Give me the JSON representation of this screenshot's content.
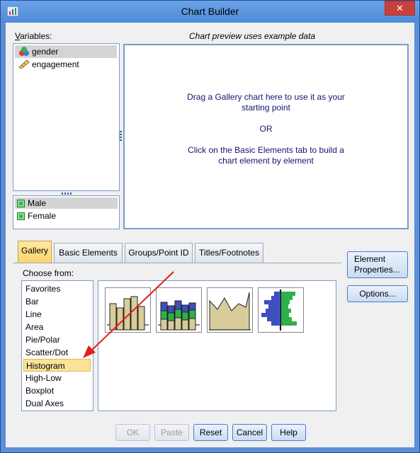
{
  "window": {
    "title": "Chart Builder",
    "close_symbol": "✕"
  },
  "variables": {
    "label": "Variables:",
    "label_underline": "V",
    "label_rest": "ariables:",
    "items": [
      {
        "name": "gender",
        "icon": "nominal-variable-icon",
        "selected": true
      },
      {
        "name": "engagement",
        "icon": "scale-variable-icon",
        "selected": false
      }
    ]
  },
  "categories": {
    "items": [
      {
        "name": "Male",
        "selected": true
      },
      {
        "name": "Female",
        "selected": false
      }
    ]
  },
  "preview": {
    "header": "Chart preview uses example data",
    "line1": "Drag a Gallery chart here to use it as your",
    "line2": "starting point",
    "line3": "OR",
    "line4": "Click on the Basic Elements tab to build a",
    "line5": "chart element by element"
  },
  "tabs": [
    {
      "label": "Gallery",
      "active": true
    },
    {
      "label": "Basic Elements",
      "active": false
    },
    {
      "label": "Groups/Point ID",
      "active": false
    },
    {
      "label": "Titles/Footnotes",
      "active": false
    }
  ],
  "gallery": {
    "choose_label": "Choose from:",
    "items": [
      "Favorites",
      "Bar",
      "Line",
      "Area",
      "Pie/Polar",
      "Scatter/Dot",
      "Histogram",
      "High-Low",
      "Boxplot",
      "Dual Axes"
    ],
    "selected": "Histogram",
    "thumbnails": [
      "simple-histogram-icon",
      "stacked-histogram-icon",
      "frequency-polygon-icon",
      "population-pyramid-icon"
    ]
  },
  "side_buttons": {
    "element_properties_line1": "Element",
    "element_properties_line2": "Properties...",
    "options": "Options..."
  },
  "bottom_buttons": {
    "ok": "OK",
    "paste": "Paste",
    "reset": "Reset",
    "cancel": "Cancel",
    "help": "Help"
  },
  "colors": {
    "accent_tab": "#ffd36a",
    "preview_text": "#15156c",
    "annotation_arrow": "#e02020",
    "thumb_tan": "#d8cc9a",
    "thumb_blue": "#3e4fc0",
    "thumb_green": "#2fb04a"
  }
}
